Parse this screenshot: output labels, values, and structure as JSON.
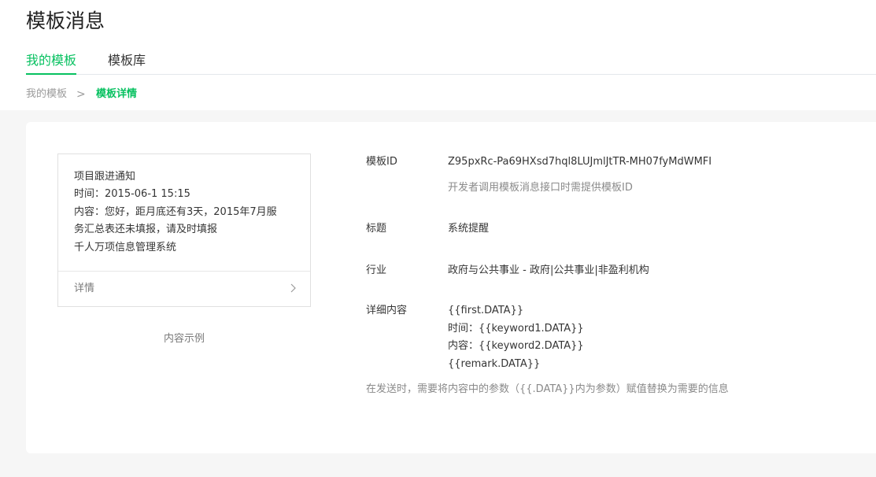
{
  "page": {
    "title": "模板消息"
  },
  "tabs": [
    {
      "label": "我的模板",
      "active": true
    },
    {
      "label": "模板库",
      "active": false
    }
  ],
  "breadcrumb": {
    "parent": "我的模板",
    "separator": ">",
    "current": "模板详情"
  },
  "preview": {
    "lines": [
      "项目跟进通知",
      "时间：2015-06-1 15:15",
      "内容：您好，距月底还有3天，2015年7月服",
      "务汇总表还未填报，请及时填报",
      "千人万项信息管理系统"
    ],
    "detail_label": "详情",
    "caption": "内容示例"
  },
  "fields": {
    "template_id": {
      "label": "模板ID",
      "value": "Z95pxRc-Pa69HXsd7hql8LUJmlJtTR-MH07fyMdWMFI",
      "tip": "开发者调用模板消息接口时需提供模板ID"
    },
    "title": {
      "label": "标题",
      "value": "系统提醒"
    },
    "industry": {
      "label": "行业",
      "value": "政府与公共事业 - 政府|公共事业|非盈利机构"
    },
    "content": {
      "label": "详细内容",
      "lines": [
        "{{first.DATA}}",
        "时间：{{keyword1.DATA}}",
        "内容：{{keyword2.DATA}}",
        "{{remark.DATA}}"
      ],
      "tip": "在发送时，需要将内容中的参数（{{.DATA}}内为参数）赋值替换为需要的信息"
    }
  },
  "colors": {
    "accent": "#07c160",
    "background": "#f6f6f6",
    "card": "#ffffff",
    "muted_text": "#8a8a8a"
  }
}
